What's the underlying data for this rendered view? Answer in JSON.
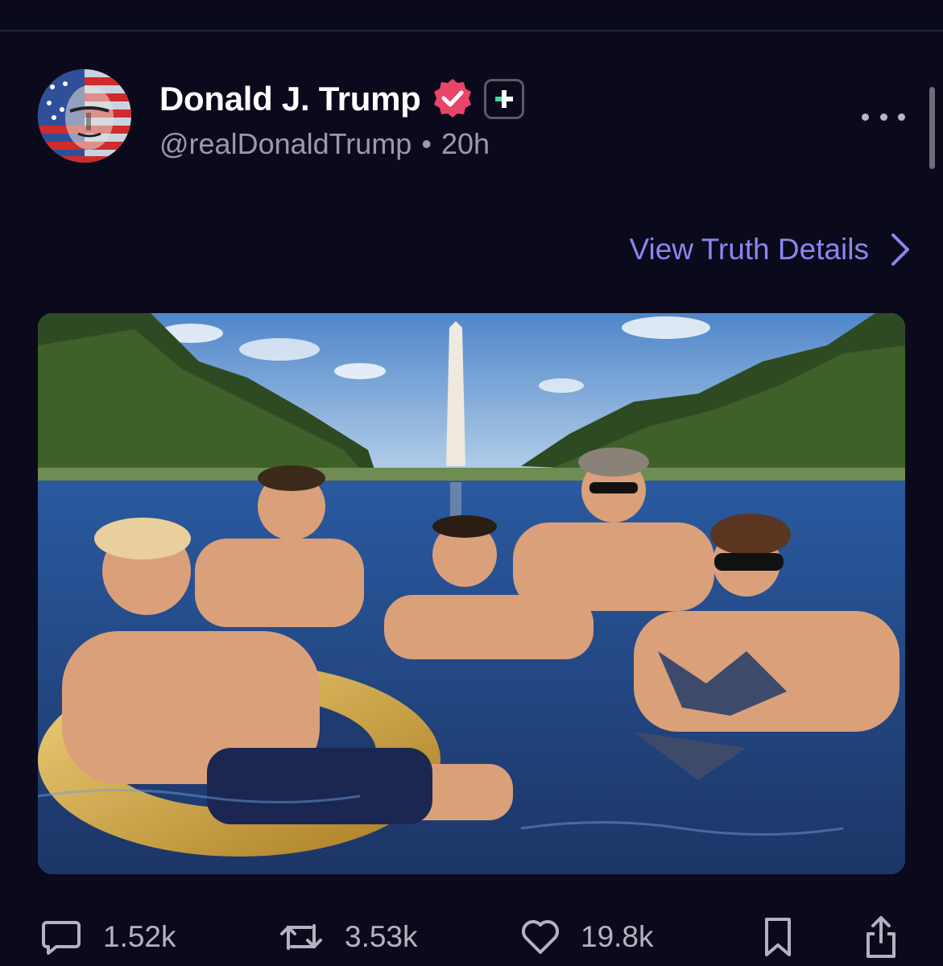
{
  "post": {
    "author": {
      "display_name": "Donald J. Trump",
      "handle": "@realDonaldTrump",
      "verified": true,
      "badge": "plus"
    },
    "timestamp": "20h",
    "separator": "•",
    "details_link": "View Truth Details",
    "image_alt": "Five people lounging in the Lincoln Memorial Reflecting Pool with the Washington Monument in the background",
    "stats": {
      "replies": "1.52k",
      "retruths": "3.53k",
      "likes": "19.8k"
    }
  },
  "colors": {
    "background": "#0b0a1c",
    "link": "#8b85f0",
    "verified_badge": "#e9456b",
    "muted_text": "#9a9aa8",
    "icon": "#b3b3bf"
  },
  "icons": {
    "reply": "speech-bubble-icon",
    "retruth": "repost-arrows-icon",
    "like": "heart-icon",
    "bookmark": "bookmark-icon",
    "share": "share-icon",
    "more": "ellipsis-icon",
    "chevron": "chevron-right-icon",
    "verified": "verified-badge-icon",
    "plus": "plus-badge-icon"
  }
}
